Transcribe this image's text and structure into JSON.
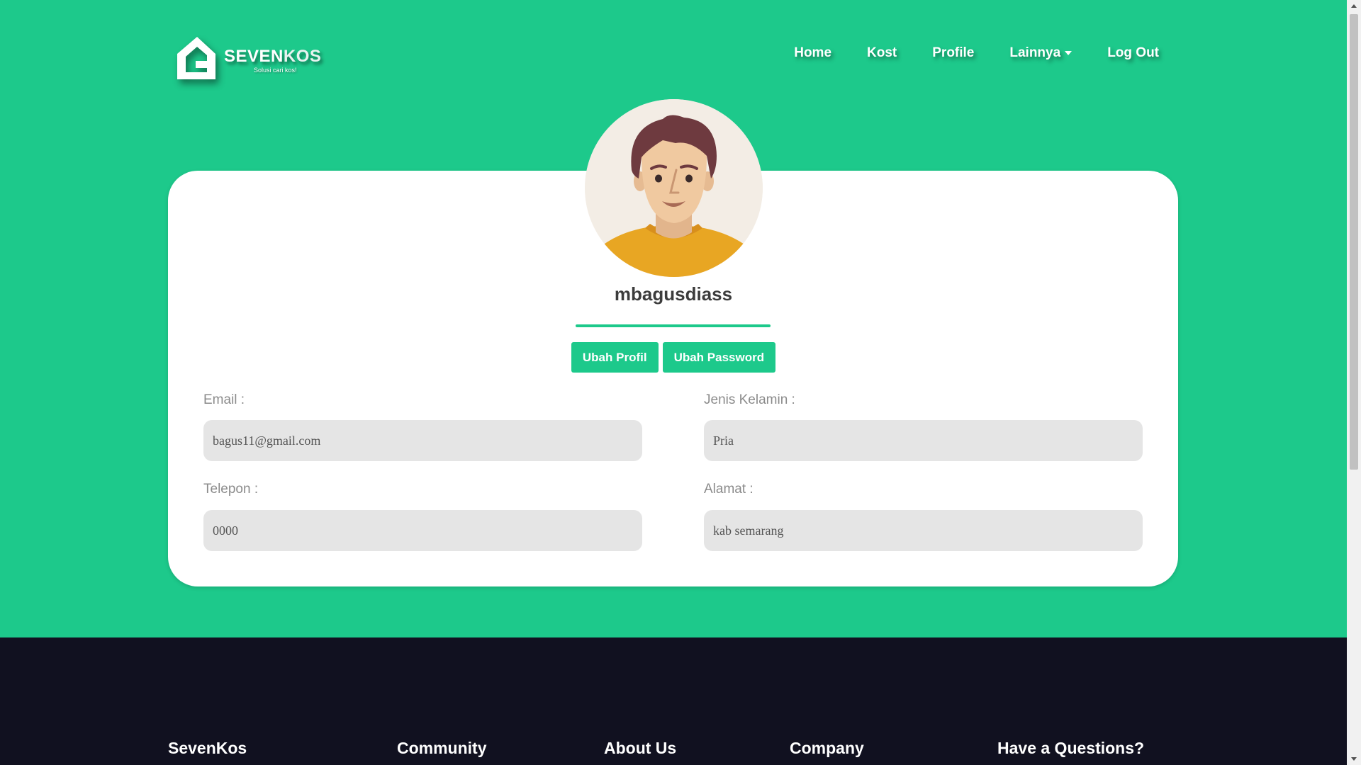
{
  "brand": {
    "name_part1": "SEVEN",
    "name_part2": "KOS",
    "tagline": "Solusi cari kos!"
  },
  "nav": {
    "home": "Home",
    "kost": "Kost",
    "profile": "Profile",
    "lainnya": "Lainnya",
    "logout": "Log Out"
  },
  "profile": {
    "username": "mbagusdiass",
    "edit_profile_label": "Ubah Profil",
    "change_password_label": "Ubah Password",
    "email_label": "Email :",
    "email_value": "bagus11@gmail.com",
    "gender_label": "Jenis Kelamin :",
    "gender_value": "Pria",
    "phone_label": "Telepon :",
    "phone_value": "0000",
    "address_label": "Alamat :",
    "address_value": "kab semarang"
  },
  "footer": {
    "col1": "SevenKos",
    "col2": "Community",
    "col3": "About Us",
    "col4": "Company",
    "col5": "Have a Questions?"
  },
  "colors": {
    "primary": "#1dc98b",
    "footer_bg": "#111120",
    "field_bg": "#e5e5e5"
  }
}
